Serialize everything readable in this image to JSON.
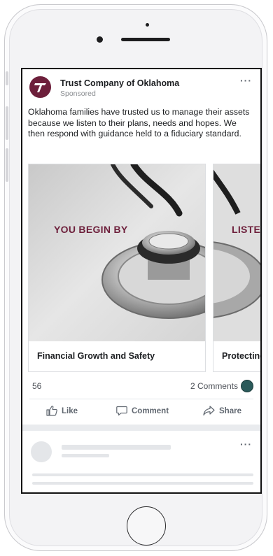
{
  "post": {
    "page_name": "Trust Company of Oklahoma",
    "sponsored_label": "Sponsored",
    "more_glyph": "···",
    "text": "Oklahoma families have trusted us to manage their assets because we listen to their plans, needs and hopes. We then respond with guidance held to a fiduciary standard.",
    "brand_color": "#6d1f3b"
  },
  "carousel": {
    "cards": [
      {
        "overlay": "YOU BEGIN BY",
        "title": "Financial Growth and Safety"
      },
      {
        "overlay": "LISTEN",
        "title": "Protecting"
      }
    ]
  },
  "stats": {
    "likes": "56",
    "comments": "2 Comments"
  },
  "actions": {
    "like": "Like",
    "comment": "Comment",
    "share": "Share"
  },
  "placeholder": {
    "more_glyph": "···"
  }
}
